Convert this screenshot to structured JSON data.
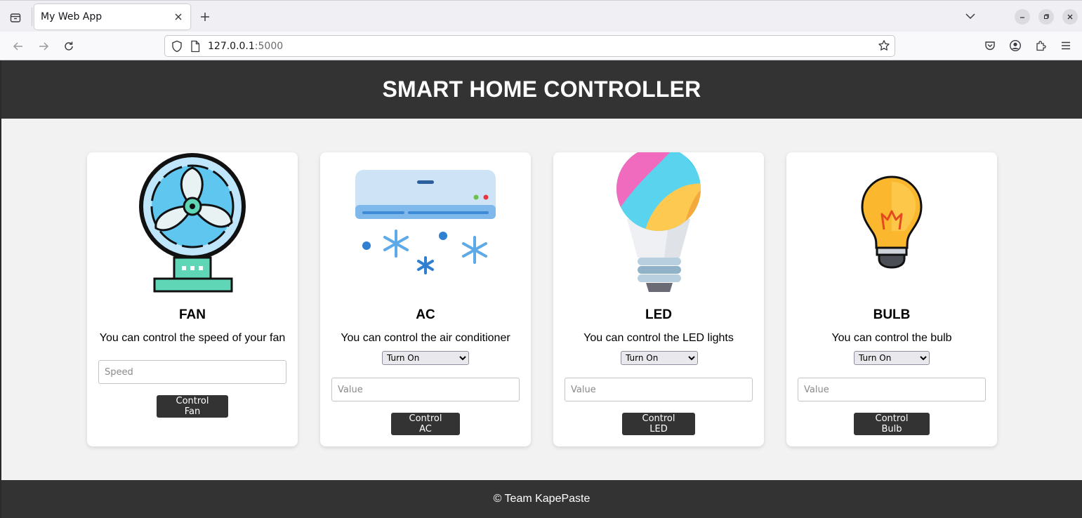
{
  "browser": {
    "tab_title": "My Web App",
    "url_host": "127.0.0.1",
    "url_port": ":5000",
    "icons": [
      "tab-list-icon",
      "close-icon",
      "plus-icon",
      "chevron-down-icon",
      "minimize-icon",
      "restore-icon",
      "window-close-icon",
      "back-arrow-icon",
      "forward-arrow-icon",
      "reload-icon",
      "shield-icon",
      "page-icon",
      "star-icon",
      "pocket-icon",
      "account-icon",
      "extensions-icon",
      "menu-icon"
    ]
  },
  "header": {
    "title": "SMART HOME CONTROLLER"
  },
  "cards": {
    "fan": {
      "title": "FAN",
      "description": "You can control the speed of your fan",
      "input_placeholder": "Speed",
      "button_label": "Control Fan"
    },
    "ac": {
      "title": "AC",
      "description": "You can control the air conditioner",
      "select_value": "Turn On",
      "input_placeholder": "Value",
      "button_label": "Control AC"
    },
    "led": {
      "title": "LED",
      "description": "You can control the LED lights",
      "select_value": "Turn On",
      "input_placeholder": "Value",
      "button_label": "Control LED"
    },
    "bulb": {
      "title": "BULB",
      "description": "You can control the bulb",
      "select_value": "Turn On",
      "input_placeholder": "Value",
      "button_label": "Control Bulb"
    }
  },
  "footer": {
    "text": "© Team KapePaste"
  },
  "colors": {
    "header_bg": "#333333",
    "page_bg": "#f2f2f2",
    "card_bg": "#ffffff",
    "button_bg": "#333333"
  }
}
